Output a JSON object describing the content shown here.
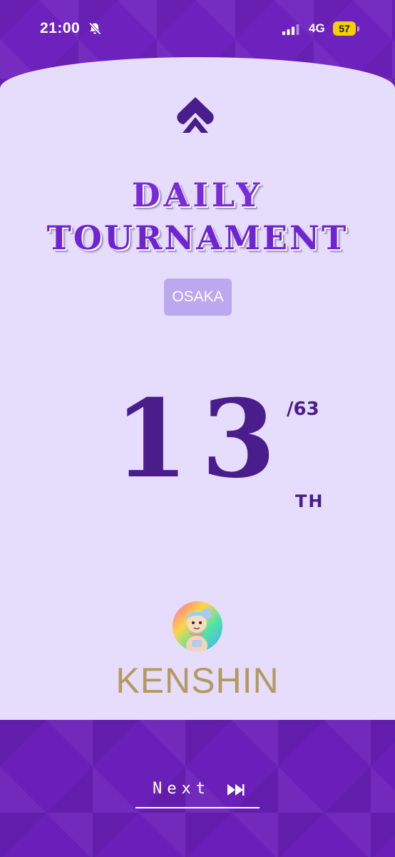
{
  "status_bar": {
    "time": "21:00",
    "network": "4G",
    "battery": "57",
    "icons": [
      "bell-slash-icon",
      "signal-icon"
    ]
  },
  "logo": {
    "icon": "spade-icon"
  },
  "tournament": {
    "title_line1": "DAILY",
    "title_line2": "TOURNAMENT",
    "city": "OSAKA"
  },
  "result": {
    "rank": "13",
    "total": "/63",
    "suffix": "TH"
  },
  "player": {
    "name": "KENSHIN",
    "avatar_icon": "nft-avatar"
  },
  "footer": {
    "next_label": "Next",
    "next_icon": "fast-forward-icon"
  },
  "colors": {
    "brand_purple": "#6d22bd",
    "card_background": "#e6dcfb",
    "rank_color": "#4a1d8c",
    "name_gold": "#b49a5f",
    "city_chip": "#bba8ef"
  }
}
